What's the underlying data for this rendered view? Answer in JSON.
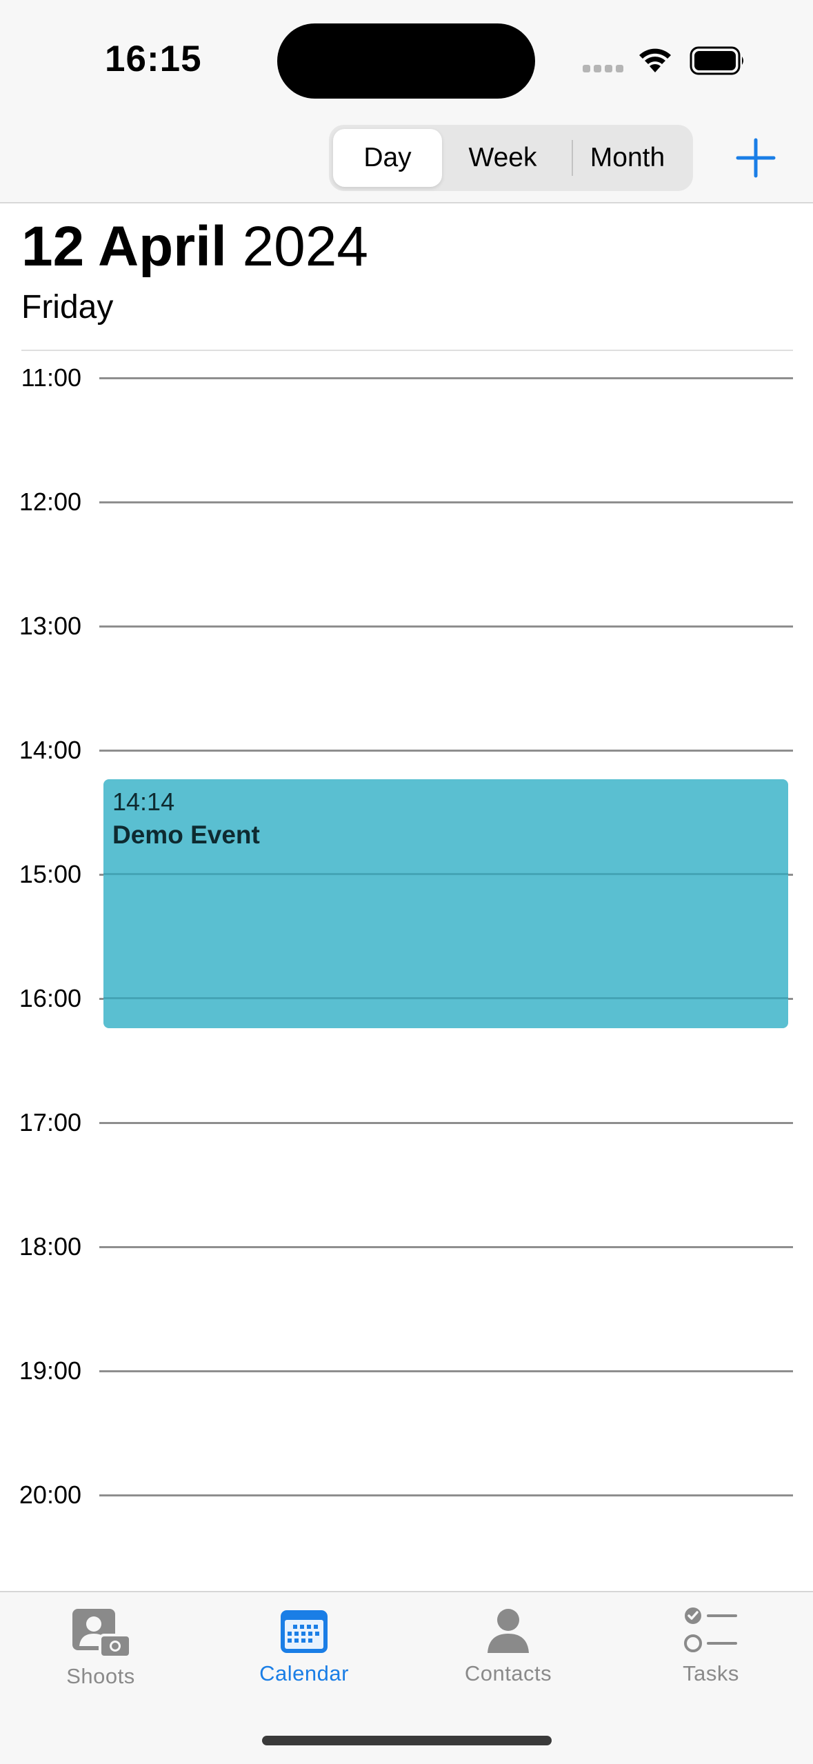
{
  "status_bar": {
    "time": "16:15"
  },
  "view_switcher": {
    "options": [
      "Day",
      "Week",
      "Month"
    ],
    "selected": "Day"
  },
  "header": {
    "day_month": "12 April",
    "year": "2024",
    "weekday": "Friday"
  },
  "timeline": {
    "hours": [
      "11:00",
      "12:00",
      "13:00",
      "14:00",
      "15:00",
      "16:00",
      "17:00",
      "18:00",
      "19:00",
      "20:00"
    ]
  },
  "event": {
    "time": "14:14",
    "title": "Demo Event",
    "color": "#5abfd1"
  },
  "tabs": [
    {
      "label": "Shoots",
      "icon": "person-camera-icon",
      "active": false
    },
    {
      "label": "Calendar",
      "icon": "calendar-icon",
      "active": true
    },
    {
      "label": "Contacts",
      "icon": "person-icon",
      "active": false
    },
    {
      "label": "Tasks",
      "icon": "checklist-icon",
      "active": false
    }
  ],
  "colors": {
    "accent": "#1a7ee6"
  }
}
